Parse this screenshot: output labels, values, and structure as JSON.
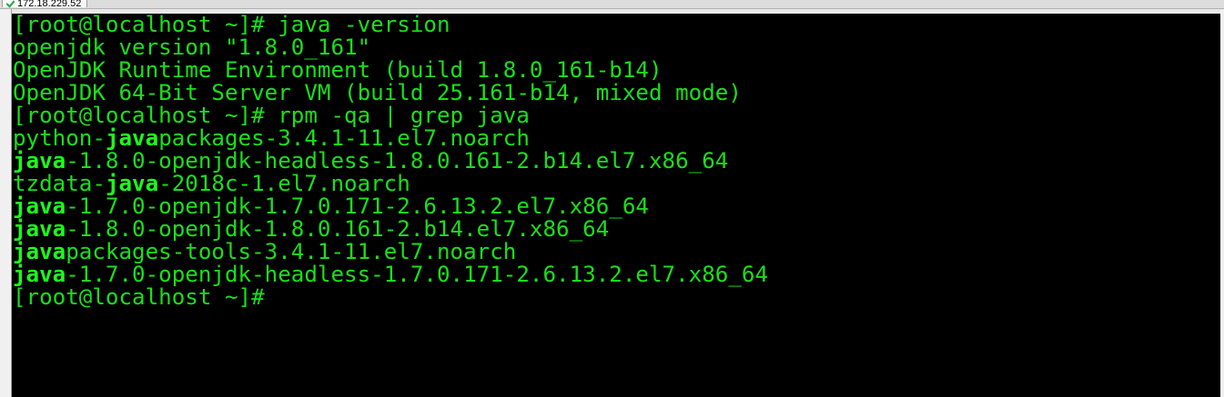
{
  "tab": {
    "label": "172.18.229.52",
    "icon": "check-icon",
    "icon_color": "#2fa84f"
  },
  "terminal": {
    "fg_color": "#19e019",
    "bg_color": "#000000",
    "lines": [
      {
        "segments": [
          {
            "text": "[root@localhost ~]# java -version",
            "hl": false
          }
        ]
      },
      {
        "segments": [
          {
            "text": "openjdk version \"1.8.0_161\"",
            "hl": false
          }
        ]
      },
      {
        "segments": [
          {
            "text": "OpenJDK Runtime Environment (build 1.8.0_161-b14)",
            "hl": false
          }
        ]
      },
      {
        "segments": [
          {
            "text": "OpenJDK 64-Bit Server VM (build 25.161-b14, mixed mode)",
            "hl": false
          }
        ]
      },
      {
        "segments": [
          {
            "text": "[root@localhost ~]# rpm -qa | grep java",
            "hl": false
          }
        ]
      },
      {
        "segments": [
          {
            "text": "python-",
            "hl": false
          },
          {
            "text": "java",
            "hl": true
          },
          {
            "text": "packages-3.4.1-11.el7.noarch",
            "hl": false
          }
        ]
      },
      {
        "segments": [
          {
            "text": "java",
            "hl": true
          },
          {
            "text": "-1.8.0-openjdk-headless-1.8.0.161-2.b14.el7.x86_64",
            "hl": false
          }
        ]
      },
      {
        "segments": [
          {
            "text": "tzdata-",
            "hl": false
          },
          {
            "text": "java",
            "hl": true
          },
          {
            "text": "-2018c-1.el7.noarch",
            "hl": false
          }
        ]
      },
      {
        "segments": [
          {
            "text": "java",
            "hl": true
          },
          {
            "text": "-1.7.0-openjdk-1.7.0.171-2.6.13.2.el7.x86_64",
            "hl": false
          }
        ]
      },
      {
        "segments": [
          {
            "text": "java",
            "hl": true
          },
          {
            "text": "-1.8.0-openjdk-1.8.0.161-2.b14.el7.x86_64",
            "hl": false
          }
        ]
      },
      {
        "segments": [
          {
            "text": "java",
            "hl": true
          },
          {
            "text": "packages-tools-3.4.1-11.el7.noarch",
            "hl": false
          }
        ]
      },
      {
        "segments": [
          {
            "text": "java",
            "hl": true
          },
          {
            "text": "-1.7.0-openjdk-headless-1.7.0.171-2.6.13.2.el7.x86_64",
            "hl": false
          }
        ]
      },
      {
        "segments": [
          {
            "text": "[root@localhost ~]# ",
            "hl": false
          }
        ]
      }
    ]
  }
}
